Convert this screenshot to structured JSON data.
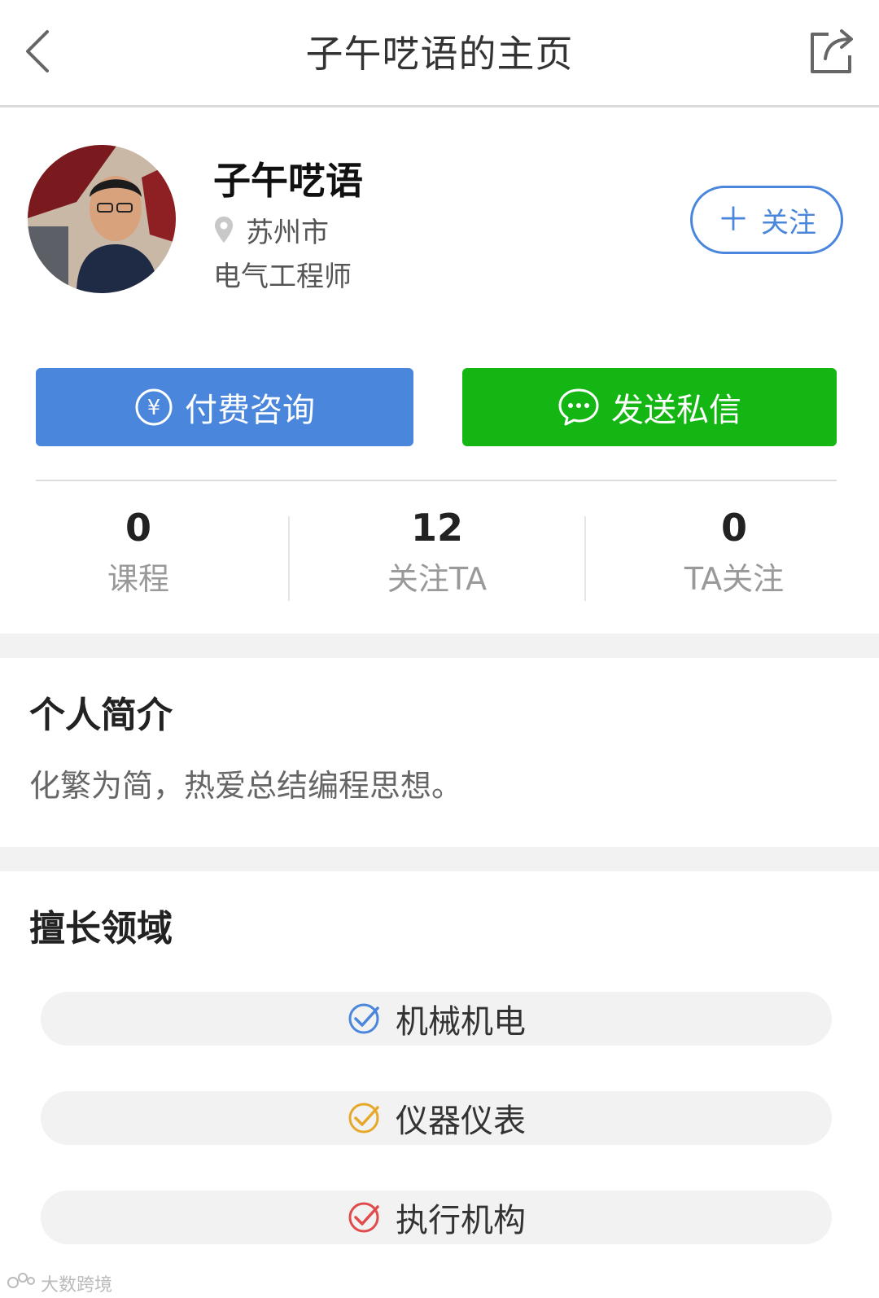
{
  "header": {
    "title": "子午呓语的主页",
    "back_icon": "chevron-left-icon",
    "share_icon": "share-icon"
  },
  "profile": {
    "name": "子午呓语",
    "location": "苏州市",
    "location_icon": "location-pin-icon",
    "occupation": "电气工程师",
    "follow_label": "关注"
  },
  "actions": {
    "pay_label": "付费咨询",
    "pay_icon": "yuan-circle-icon",
    "pay_color": "#4a86dc",
    "message_label": "发送私信",
    "message_icon": "chat-bubble-icon",
    "message_color": "#13b613"
  },
  "stats": [
    {
      "value": "0",
      "label": "课程"
    },
    {
      "value": "12",
      "label": "关注TA"
    },
    {
      "value": "0",
      "label": "TA关注"
    }
  ],
  "intro": {
    "title": "个人简介",
    "text": "化繁为简，热爱总结编程思想。"
  },
  "expertise": {
    "title": "擅长领域",
    "items": [
      {
        "label": "机械机电",
        "color": "#4a86dc"
      },
      {
        "label": "仪器仪表",
        "color": "#e6a82a"
      },
      {
        "label": "执行机构",
        "color": "#e04a4a"
      }
    ]
  },
  "watermark": {
    "text": "大数跨境"
  }
}
